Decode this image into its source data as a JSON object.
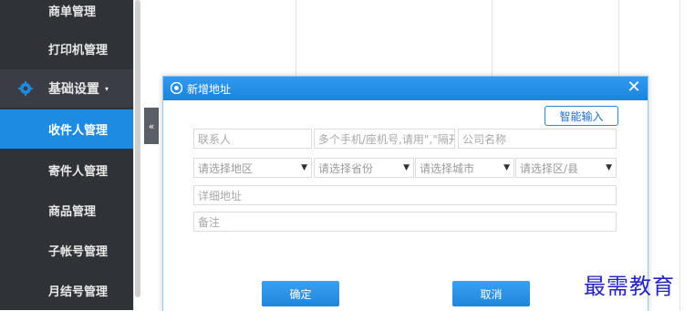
{
  "sidebar": {
    "items": [
      {
        "label": "商单管理"
      },
      {
        "label": "打印机管理"
      },
      {
        "label": "基础设置"
      },
      {
        "label": "收件人管理"
      },
      {
        "label": "寄件人管理"
      },
      {
        "label": "商品管理"
      },
      {
        "label": "子帐号管理"
      },
      {
        "label": "月结号管理"
      }
    ],
    "group_arrow": "▾",
    "collapse_glyph": "«"
  },
  "dialog": {
    "title": "新增地址",
    "close_glyph": "✕",
    "smart_input_label": "智能输入",
    "fields": {
      "contact_placeholder": "联系人",
      "phone_placeholder": "多个手机/座机号,请用\",\"隔开",
      "company_placeholder": "公司名称",
      "region_select": "请选择地区",
      "province_select": "请选择省份",
      "city_select": "请选择城市",
      "district_select": "请选择区/县",
      "address_placeholder": "详细地址",
      "remark_placeholder": "备注"
    },
    "confirm_label": "确定",
    "cancel_label": "取消"
  },
  "watermark": "最需教育",
  "colors": {
    "sidebar_bg": "#2f3237",
    "active_bg": "#1d8be2",
    "header_blue": "#1b85dc",
    "watermark": "#2424c0"
  }
}
